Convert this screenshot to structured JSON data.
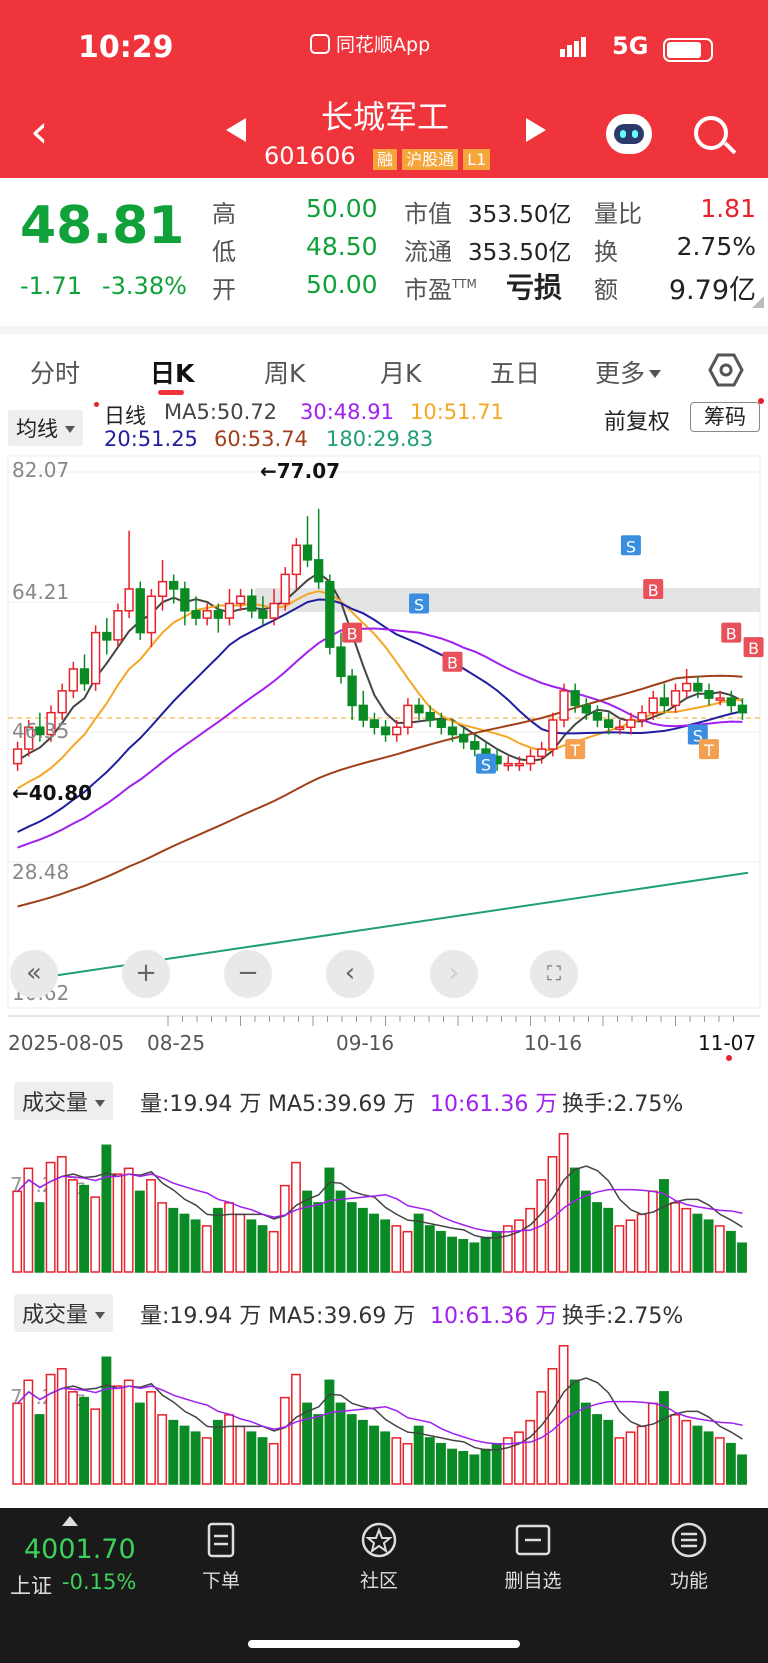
{
  "status_bar": {
    "time": "10:29",
    "app_label": "同花顺App",
    "network": "5G"
  },
  "header": {
    "stock_name": "长城军工",
    "stock_code": "601606",
    "tags": [
      "融",
      "沪股通",
      "L1"
    ]
  },
  "quote": {
    "price": "48.81",
    "change": "-1.71",
    "change_pct": "-3.38%",
    "stats": [
      {
        "label": "高",
        "value": "50.00"
      },
      {
        "label": "低",
        "value": "48.50"
      },
      {
        "label": "开",
        "value": "50.00"
      }
    ],
    "market": [
      {
        "label": "市值",
        "value": "353.50亿"
      },
      {
        "label": "流通",
        "value": "353.50亿"
      },
      {
        "label": "市盈",
        "sup": "TTM",
        "value": "亏损"
      }
    ],
    "ratios": [
      {
        "label": "量比",
        "value": "1.81"
      },
      {
        "label": "换",
        "value": "2.75%"
      },
      {
        "label": "额",
        "value": "9.79亿"
      }
    ]
  },
  "tabs": [
    "分时",
    "日K",
    "周K",
    "月K",
    "五日",
    "更多"
  ],
  "active_tab": "日K",
  "kline": {
    "ma_selector": "均线",
    "line_type": "日线",
    "ma5": "MA5:50.72",
    "ma30": "30:48.91",
    "ma10": "10:51.71",
    "ma20": "20:51.25",
    "ma60": "60:53.74",
    "ma180": "180:29.83",
    "adjust_label": "前复权",
    "chip_button": "筹码",
    "y_ticks": [
      "82.07",
      "64.21",
      "46.35",
      "28.48",
      "10.62"
    ],
    "max_label": "←77.07",
    "min_label": "←40.80",
    "x_ticks": [
      "2025-08-05",
      "08-25",
      "09-16",
      "10-16",
      "11-07"
    ],
    "colors": {
      "up": "#e8212a",
      "down": "#0a8a24",
      "ma5": "#444444",
      "ma10": "#f5a623",
      "ma20": "#1f1fa0",
      "ma30": "#a020f0",
      "ma60": "#a0401a",
      "ma180": "#20a070"
    }
  },
  "volume_panels": [
    {
      "selector": "成交量",
      "vol": "量:19.94 万",
      "ma5": "MA5:39.69 万",
      "ma10": "10:61.36 万",
      "turnover": "换手:2.75%",
      "y_label": "71.21万"
    },
    {
      "selector": "成交量",
      "vol": "量:19.94 万",
      "ma5": "MA5:39.69 万",
      "ma10": "10:61.36 万",
      "turnover": "换手:2.75%",
      "y_label": "71.21万"
    }
  ],
  "bottom_nav": {
    "index_value": "4001.70",
    "index_name": "上证",
    "index_change": "-0.15%",
    "items": [
      {
        "label": "下单",
        "icon": "order-icon"
      },
      {
        "label": "社区",
        "icon": "community-icon"
      },
      {
        "label": "删自选",
        "icon": "remove-watchlist-icon"
      },
      {
        "label": "功能",
        "icon": "menu-icon"
      }
    ]
  }
}
